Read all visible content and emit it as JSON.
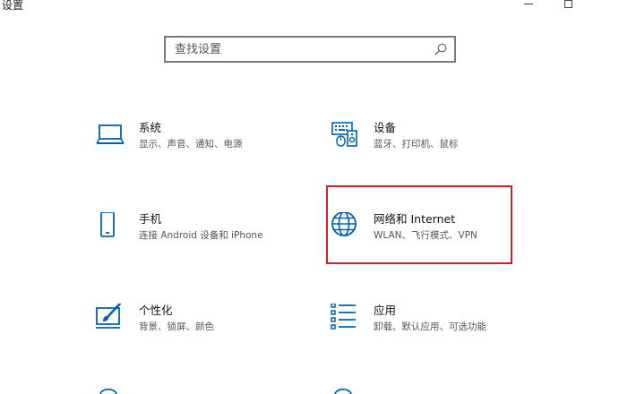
{
  "window": {
    "title": "设置"
  },
  "search": {
    "placeholder": "查找设置"
  },
  "accent_color": "#0063b1",
  "highlight_color": "#c0272d",
  "tiles": [
    {
      "id": "system",
      "icon": "laptop-icon",
      "name": "系统",
      "desc": "显示、声音、通知、电源"
    },
    {
      "id": "devices",
      "icon": "devices-icon",
      "name": "设备",
      "desc": "蓝牙、打印机、鼠标"
    },
    {
      "id": "phone",
      "icon": "phone-icon",
      "name": "手机",
      "desc": "连接 Android 设备和 iPhone"
    },
    {
      "id": "network",
      "icon": "globe-icon",
      "name": "网络和 Internet",
      "desc": "WLAN、飞行模式、VPN"
    },
    {
      "id": "personalization",
      "icon": "paintbrush-icon",
      "name": "个性化",
      "desc": "背景、锁屏、颜色"
    },
    {
      "id": "apps",
      "icon": "apps-list-icon",
      "name": "应用",
      "desc": "卸载、默认应用、可选功能"
    }
  ]
}
